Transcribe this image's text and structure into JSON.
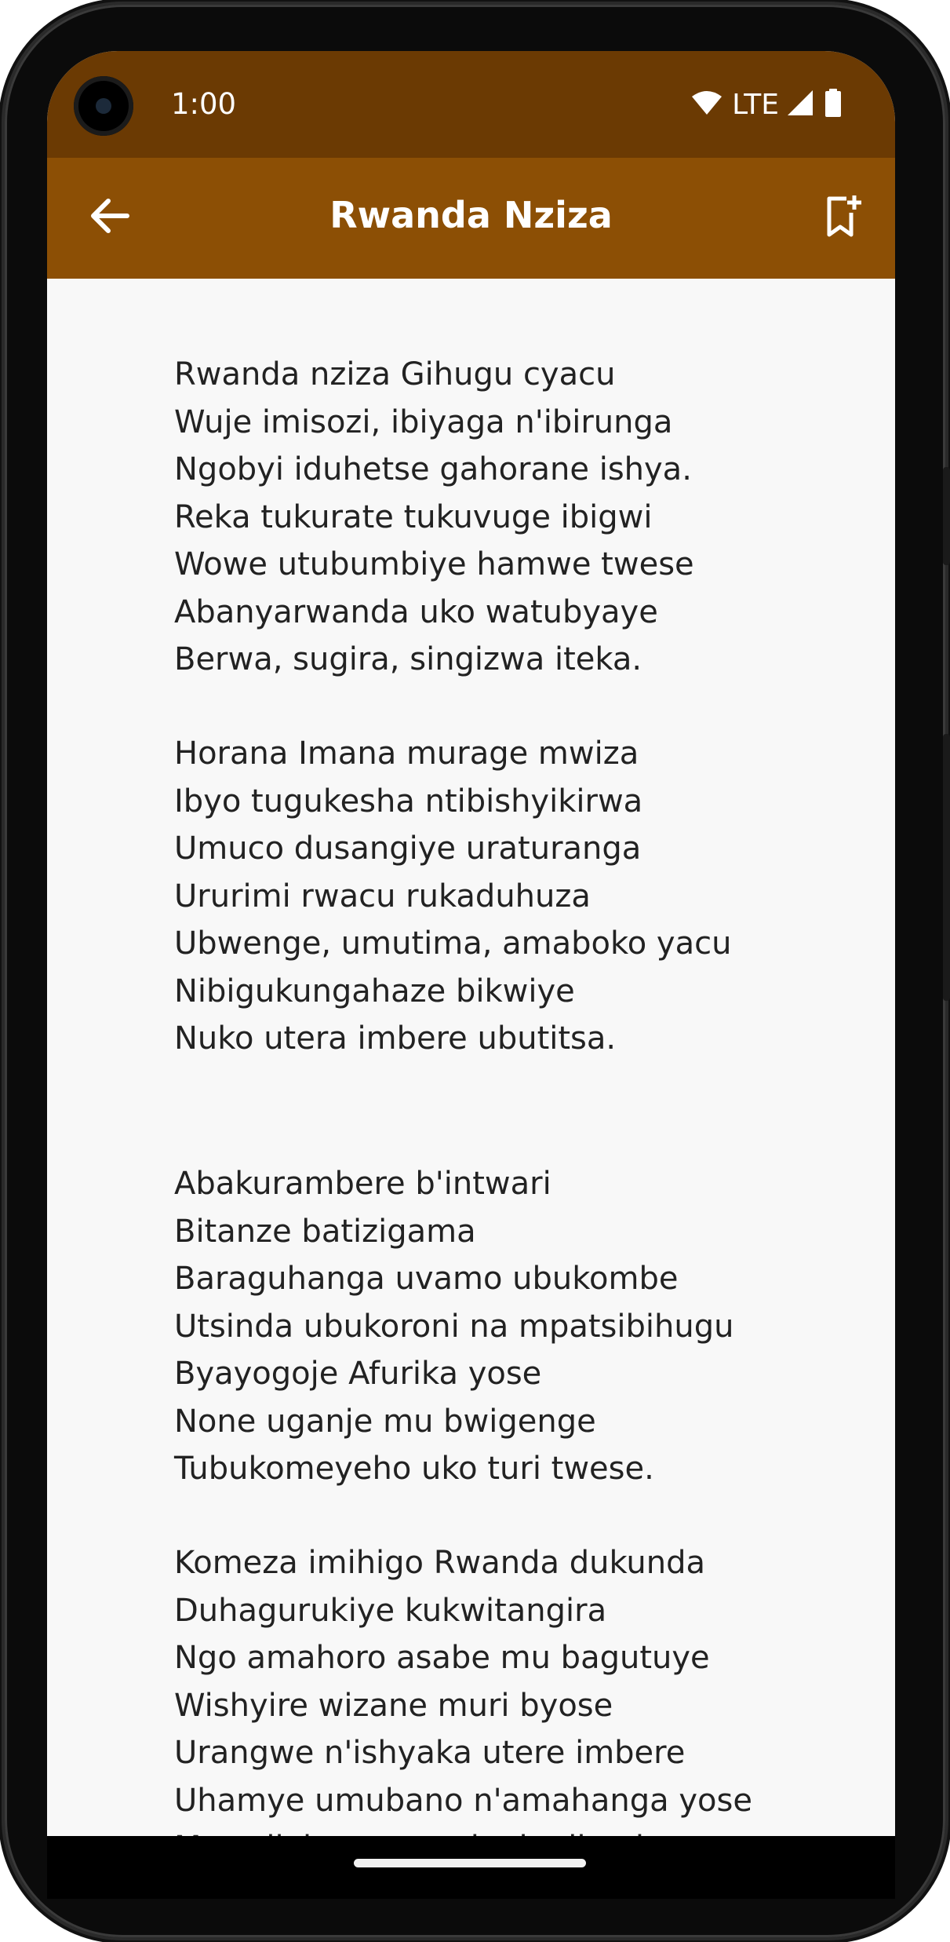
{
  "status_bar": {
    "time": "1:00",
    "network": "LTE",
    "icons": [
      "wifi-icon",
      "cell-signal-icon",
      "battery-icon"
    ]
  },
  "app_bar": {
    "title": "Rwanda Nziza",
    "back_icon": "arrow-left-icon",
    "action_icon": "bookmark-add-icon"
  },
  "colors": {
    "status_bar": "#6b3a03",
    "app_bar": "#8c4f05",
    "background": "#f8f8f8",
    "text": "#222222"
  },
  "lyrics": {
    "stanzas": [
      {
        "lines": [
          "Rwanda nziza Gihugu cyacu",
          "Wuje imisozi, ibiyaga n'ibirunga",
          "Ngobyi iduhetse gahorane ishya.",
          "Reka tukurate tukuvuge ibigwi",
          "Wowe utubumbiye hamwe twese",
          "Abanyarwanda uko watubyaye",
          "Berwa, sugira, singizwa iteka."
        ]
      },
      {
        "lines": [
          "Horana Imana murage mwiza",
          "Ibyo tugukesha ntibishyikirwa",
          "Umuco dusangiye uraturanga",
          "Ururimi rwacu rukaduhuza",
          "Ubwenge, umutima, amaboko yacu",
          "Nibigukungahaze bikwiye",
          "Nuko utera imbere ubutitsa."
        ]
      },
      {
        "lines": [
          "Abakurambere b'intwari",
          "Bitanze batizigama",
          "Baraguhanga uvamo ubukombe",
          "Utsinda ubukoroni na mpatsibihugu",
          "Byayogoje Afurika yose",
          "None uganje mu bwigenge",
          "Tubukomeyeho uko turi twese."
        ]
      },
      {
        "lines": [
          "Komeza imihigo Rwanda dukunda",
          "Duhagurukiye kukwitangira",
          "Ngo amahoro asabe mu bagutuye",
          "Wishyire wizane muri byose",
          "Urangwe n'ishyaka utere imbere",
          "Uhamye umubano n'amahanga yose",
          "Maze ijabo ryawe riguhe ijambo."
        ]
      }
    ]
  }
}
